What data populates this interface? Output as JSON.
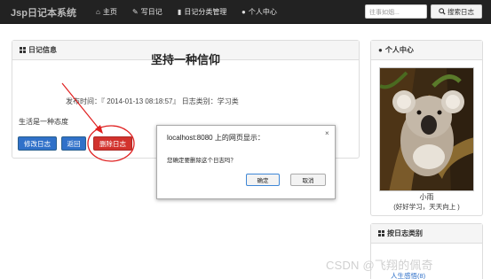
{
  "navbar": {
    "brand": "Jsp日记本系统",
    "items": [
      {
        "icon": "home-icon",
        "glyph": "⌂",
        "label": "主页"
      },
      {
        "icon": "pencil-icon",
        "glyph": "✎",
        "label": "写日记"
      },
      {
        "icon": "book-icon",
        "glyph": "▮",
        "label": "日记分类管理"
      },
      {
        "icon": "user-icon",
        "glyph": "●",
        "label": "个人中心"
      }
    ],
    "search": {
      "placeholder": "往事如烟...",
      "button": "搜索日志"
    }
  },
  "diary": {
    "panel_title": "日记信息",
    "title": "坚持一种信仰",
    "meta": "发布时间：『 2014-01-13 08:18:57』  日志类别：学习类",
    "content": "生活是一种态度",
    "buttons": {
      "edit": "修改日志",
      "back": "返回",
      "delete": "删除日志"
    }
  },
  "sidebar": {
    "profile_title": "个人中心",
    "nickname": "小雨",
    "signature": "(好好学习，天天向上 )",
    "category_title": "按日志类别",
    "categories": [
      "人生感悟(8)"
    ]
  },
  "dialog": {
    "title": "localhost:8080 上的网页显示：",
    "message": "您确定要删除这个日志吗？",
    "ok": "确定",
    "cancel": "取消",
    "close": "×"
  },
  "watermark": "CSDN @飞翔的佩奇",
  "colors": {
    "primary": "#3071c9",
    "danger": "#d2322d",
    "navbar": "#222222",
    "annotation": "#e02020"
  }
}
